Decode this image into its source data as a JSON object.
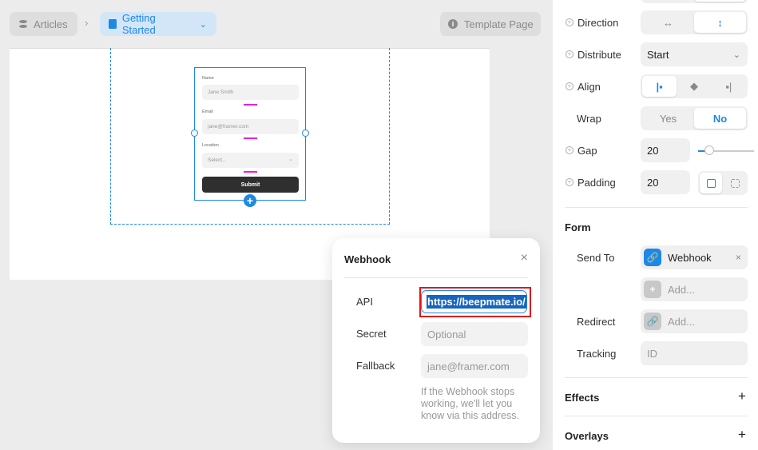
{
  "breadcrumb": {
    "root": "Articles",
    "separator": "›",
    "current": "Getting Started",
    "current_chevron": "⌄"
  },
  "template_button": {
    "label": "Template Page",
    "icon": "info-icon"
  },
  "canvas_form": {
    "fields": [
      {
        "label": "Name",
        "placeholder": "Jane Smith"
      },
      {
        "label": "Email",
        "placeholder": "jane@framer.com"
      },
      {
        "label": "Location",
        "placeholder": "Select..."
      }
    ],
    "submit_label": "Submit"
  },
  "webhook_popover": {
    "title": "Webhook",
    "close": "×",
    "rows": [
      {
        "label": "API",
        "value": "https://beepmate.io/"
      },
      {
        "label": "Secret",
        "placeholder": "Optional"
      },
      {
        "label": "Fallback",
        "placeholder": "jane@framer.com"
      }
    ],
    "help": "If the Webhook stops working, we'll let you know via this address."
  },
  "layout_panel": {
    "direction": {
      "label": "Direction",
      "options": [
        "↔",
        "↕"
      ],
      "selected": 1
    },
    "distribute": {
      "label": "Distribute",
      "value": "Start",
      "chevron": "⌄"
    },
    "align": {
      "label": "Align",
      "options": [
        "|▪",
        "◆",
        "▪|"
      ],
      "selected": 0
    },
    "wrap": {
      "label": "Wrap",
      "options": [
        "Yes",
        "No"
      ],
      "selected": 1
    },
    "gap": {
      "label": "Gap",
      "value": "20"
    },
    "padding": {
      "label": "Padding",
      "value": "20"
    }
  },
  "form_panel": {
    "title": "Form",
    "send_to": {
      "label": "Send To",
      "value": "Webhook",
      "remove": "×"
    },
    "add_placeholder": "Add...",
    "redirect": {
      "label": "Redirect",
      "placeholder": "Add..."
    },
    "tracking": {
      "label": "Tracking",
      "placeholder": "ID"
    }
  },
  "sections": {
    "effects": "Effects",
    "overlays": "Overlays",
    "plus": "+"
  },
  "colors": {
    "accent": "#1e88e5",
    "selection": "#1565c0",
    "highlight": "#e01818",
    "gap_marker": "#e91ee9"
  }
}
